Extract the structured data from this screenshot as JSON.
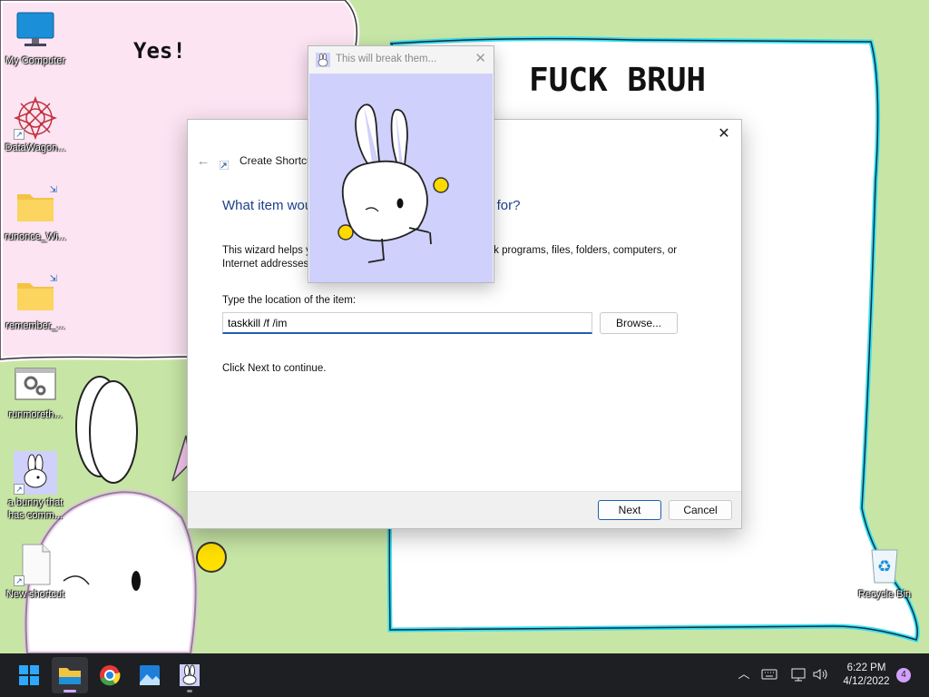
{
  "wallpaper": {
    "left_text": "Yes!",
    "right_text": "FUCK BRUH"
  },
  "desktop_icons": [
    {
      "label": "My Computer",
      "icon": "monitor-icon"
    },
    {
      "label": "DataWagon...",
      "icon": "mandala-icon"
    },
    {
      "label": "runonce_Wi...",
      "icon": "folder-icon"
    },
    {
      "label": "remember_...",
      "icon": "folder-icon"
    },
    {
      "label": "runmoreth...",
      "icon": "settings-window-icon"
    },
    {
      "label": "a bunny that has comm...",
      "icon": "bunny-icon"
    },
    {
      "label": "New shortcut",
      "icon": "blank-file-icon"
    },
    {
      "label": "Recycle Bin",
      "icon": "recycle-bin-icon"
    }
  ],
  "popup": {
    "title": "This will break them...",
    "close_glyph": "✕"
  },
  "wizard": {
    "header_title": "Create Shortcut",
    "question": "What item would you like to create a shortcut for?",
    "question_visible": "What item wo                                  ut for?",
    "description": "This wizard helps you to create shortcuts to local or network programs, files, folders, computers, or Internet addresses.",
    "location_label": "Type the location of the item:",
    "location_value": "taskkill /f /im",
    "browse_label": "Browse...",
    "continue_text": "Click Next to continue.",
    "next_label": "Next",
    "cancel_label": "Cancel",
    "close_glyph": "✕",
    "back_glyph": "←"
  },
  "taskbar": {
    "time": "6:22 PM",
    "date": "4/12/2022",
    "notification_count": "4",
    "apps": [
      "start-icon",
      "file-explorer-icon",
      "chrome-icon",
      "photos-icon",
      "bunny-app-icon"
    ]
  },
  "colors": {
    "wallpaper_green": "#c7e6a6",
    "pink_panel": "#fce4f3",
    "popup_body": "#cfd0fb",
    "accent_blue": "#1f5fae",
    "taskbar": "#1e1f22"
  }
}
